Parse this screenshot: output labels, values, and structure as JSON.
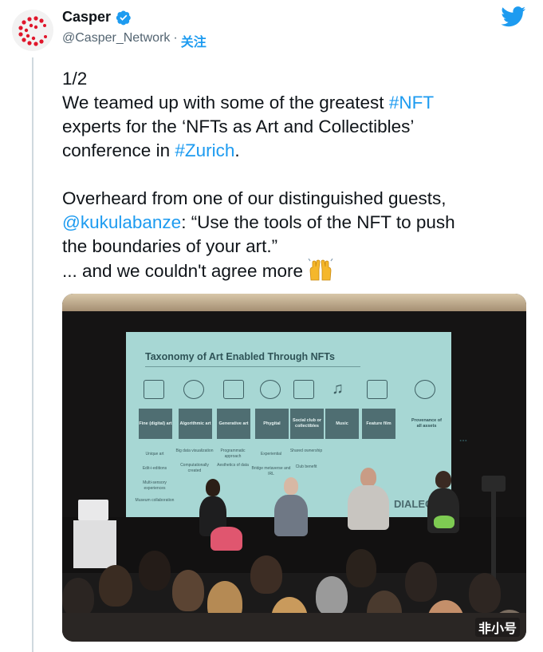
{
  "author": {
    "display_name": "Casper",
    "handle": "@Casper_Network",
    "separator": "·",
    "follow_label": "关注",
    "verified": true
  },
  "tweet": {
    "line1": "1/2",
    "p1_a": "We teamed up with some of the greatest ",
    "p1_tag": "#NFT",
    "p1_b": "experts for the ‘NFTs as Art and Collectibles’",
    "p1_c": "conference in ",
    "p1_tag2": "#Zurich",
    "p1_end": ".",
    "p2_a": "Overheard from one of our distinguished guests,",
    "p2_mention": "@kukulabanze",
    "p2_b": ": “Use the tools of the NFT to push",
    "p2_c": "the boundaries of your art.”",
    "p2_d": "... and we couldn't agree more ",
    "emoji_name": "raising-hands-emoji"
  },
  "media": {
    "screen_title": "Taxonomy of Art Enabled Through NFTs",
    "boxes": [
      "Fine (digital) art",
      "Algorithmic art",
      "Generative art",
      "Phygital",
      "Social club or collectibles",
      "Music",
      "Feature film",
      "Provenance of all assets"
    ],
    "sub_labels": [
      "Unique art",
      "Big data visualization",
      "Programmatic approach",
      "Experiential",
      "Shared ownership",
      "Edit-i-editions",
      "Computationally created",
      "Aesthetics of data",
      "Bridge metaverse and IRL",
      "Club benefit",
      "Multi-sensory experiences",
      "Museum collaboration"
    ],
    "ellipsis": "...",
    "brand_partial": "DIALEC",
    "watermark": "非小号"
  },
  "colors": {
    "link": "#1d9bf0",
    "text": "#0f1419",
    "secondary": "#536471",
    "brand_red": "#e0162b",
    "twitter_blue": "#1d9bf0"
  },
  "icons": {
    "twitter_logo": "twitter-bird-icon",
    "verified_badge": "verified-badge-icon"
  }
}
